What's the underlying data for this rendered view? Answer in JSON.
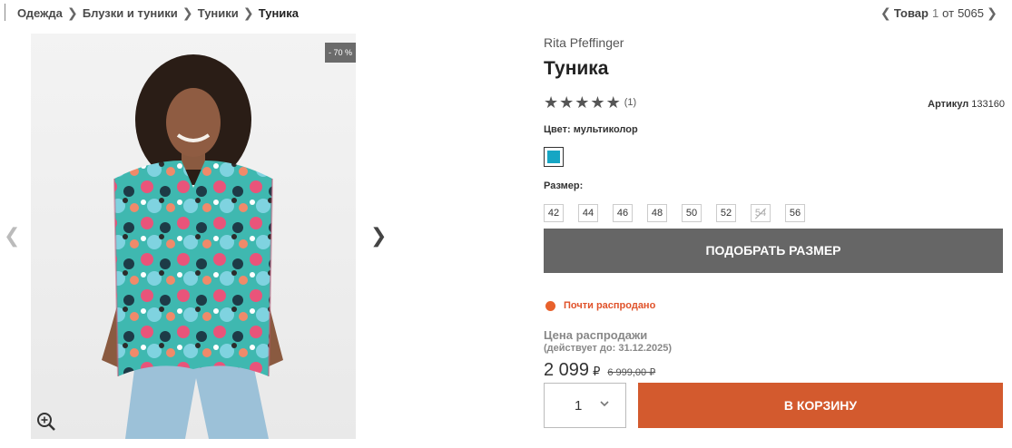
{
  "breadcrumb": {
    "items": [
      "Одежда",
      "Блузки и туники",
      "Туники",
      "Туника"
    ],
    "separator": "❯"
  },
  "pager": {
    "label": "Товар",
    "current": "1",
    "of": "от",
    "total": "5065"
  },
  "gallery": {
    "discount_badge": "- 70 %",
    "icons": {
      "prev": "chevron-left-icon",
      "next": "chevron-right-icon",
      "zoom": "zoom-in-icon"
    }
  },
  "product": {
    "brand": "Rita Pfeffinger",
    "title": "Туника",
    "rating": {
      "stars": 5,
      "max": 5,
      "count": "(1)"
    },
    "article_label": "Артикул",
    "article_number": "133160",
    "color_label": "Цвет: мультиколор",
    "swatch_color": "#16a6c4",
    "size_label": "Размер:",
    "sizes": [
      {
        "value": "42",
        "available": true
      },
      {
        "value": "44",
        "available": true
      },
      {
        "value": "46",
        "available": true
      },
      {
        "value": "48",
        "available": true
      },
      {
        "value": "50",
        "available": true
      },
      {
        "value": "52",
        "available": true
      },
      {
        "value": "54",
        "available": false
      },
      {
        "value": "56",
        "available": true
      }
    ],
    "fit_button": "ПОДОБРАТЬ РАЗМЕР",
    "stock_status": "Почти распродано",
    "sale_label": "Цена распродажи",
    "sale_until": "(действует до: 31.12.2025)",
    "price_now": "2 099",
    "currency": "₽",
    "price_old": "6 999,00 ₽",
    "quantity": "1",
    "cart_button": "В КОРЗИНУ"
  },
  "colors": {
    "accent": "#d35a2e",
    "stock_dot": "#e8612c",
    "fit_button_bg": "#666666"
  }
}
